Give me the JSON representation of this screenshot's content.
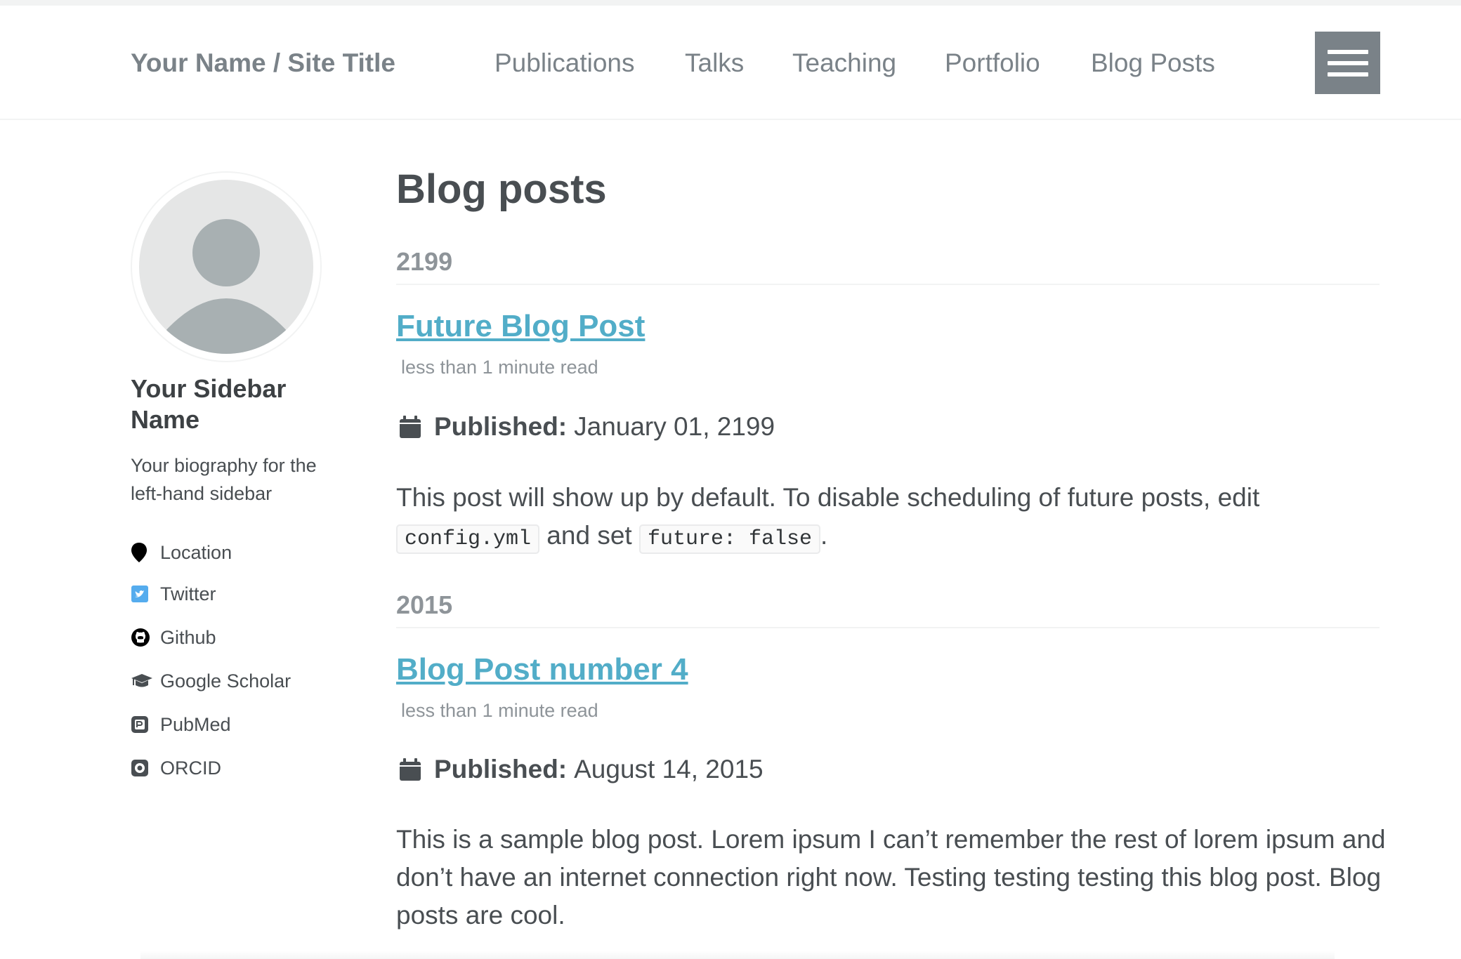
{
  "masthead": {
    "site_title": "Your Name / Site Title",
    "nav": [
      {
        "label": "Publications"
      },
      {
        "label": "Talks"
      },
      {
        "label": "Teaching"
      },
      {
        "label": "Portfolio"
      },
      {
        "label": "Blog Posts"
      }
    ],
    "menu_icon": "hamburger-icon"
  },
  "sidebar": {
    "avatar_icon": "person-silhouette-icon",
    "name": "Your Sidebar Name",
    "bio": "Your biography for the left-hand sidebar",
    "links": [
      {
        "label": "Location",
        "icon": "map-marker-icon"
      },
      {
        "label": "Twitter",
        "icon": "twitter-icon"
      },
      {
        "label": "Github",
        "icon": "github-icon"
      },
      {
        "label": "Google Scholar",
        "icon": "graduation-cap-icon"
      },
      {
        "label": "PubMed",
        "icon": "pubmed-icon"
      },
      {
        "label": "ORCID",
        "icon": "orcid-icon"
      }
    ]
  },
  "main": {
    "page_title": "Blog posts",
    "groups": [
      {
        "year": "2199",
        "posts": [
          {
            "title": "Future Blog Post",
            "read_time": "less than 1 minute read",
            "published_label": "Published:",
            "published_date": "January 01, 2199",
            "excerpt_part1": "This post will show up by default. To disable scheduling of future posts, edit ",
            "code1": "config.yml",
            "excerpt_part2": " and set ",
            "code2": "future: false",
            "excerpt_part3": "."
          }
        ]
      },
      {
        "year": "2015",
        "posts": [
          {
            "title": "Blog Post number 4",
            "read_time": "less than 1 minute read",
            "published_label": "Published:",
            "published_date": "August 14, 2015",
            "excerpt": "This is a sample blog post. Lorem ipsum I can’t remember the rest of lorem ipsum and don’t have an internet connection right now. Testing testing testing this blog post. Blog posts are cool."
          }
        ]
      }
    ]
  },
  "colors": {
    "link": "#52adc8",
    "nav_text": "#7a8288",
    "text": "#494e52",
    "muted": "#8e9499",
    "twitter": "#55acee"
  }
}
